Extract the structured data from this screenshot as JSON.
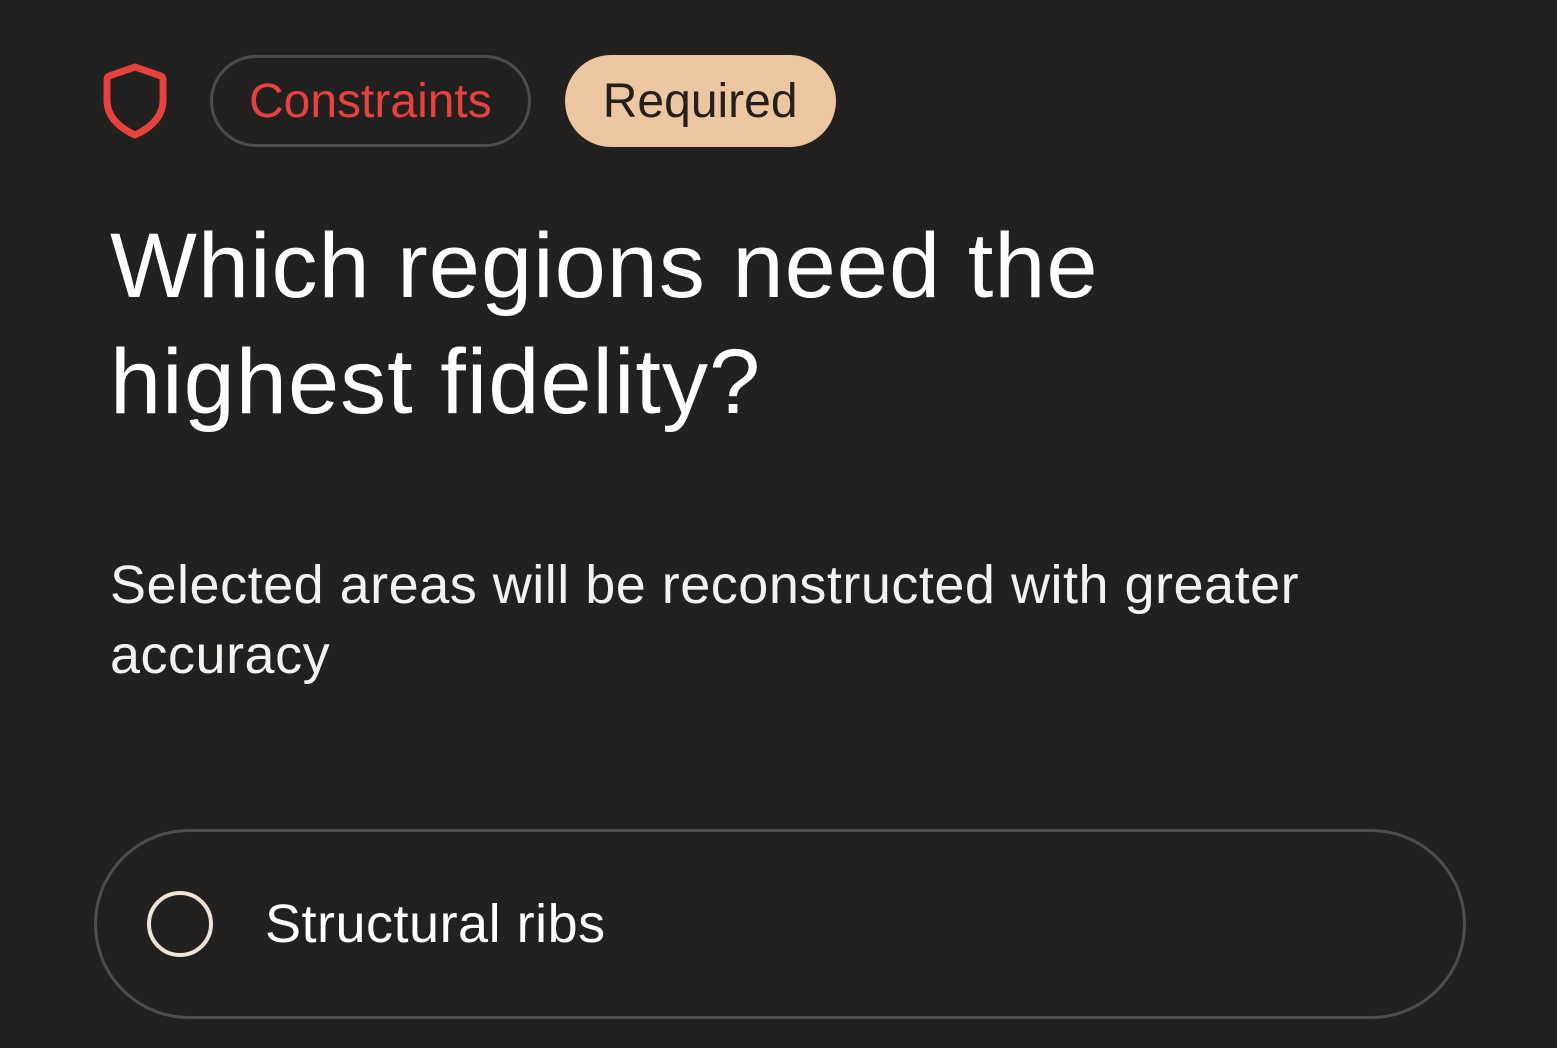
{
  "header": {
    "icon": "shield-icon",
    "category_tag": "Constraints",
    "required_tag": "Required"
  },
  "question": {
    "title": "Which regions need the highest fidelity?",
    "subtitle": "Selected areas will be reconstructed with greater accuracy"
  },
  "options": [
    {
      "label": "Structural ribs",
      "selected": false
    }
  ],
  "colors": {
    "background": "#222120",
    "accent_red": "#e8423e",
    "required_tag_bg": "#ebc6a1",
    "border": "#4f4d4b"
  }
}
